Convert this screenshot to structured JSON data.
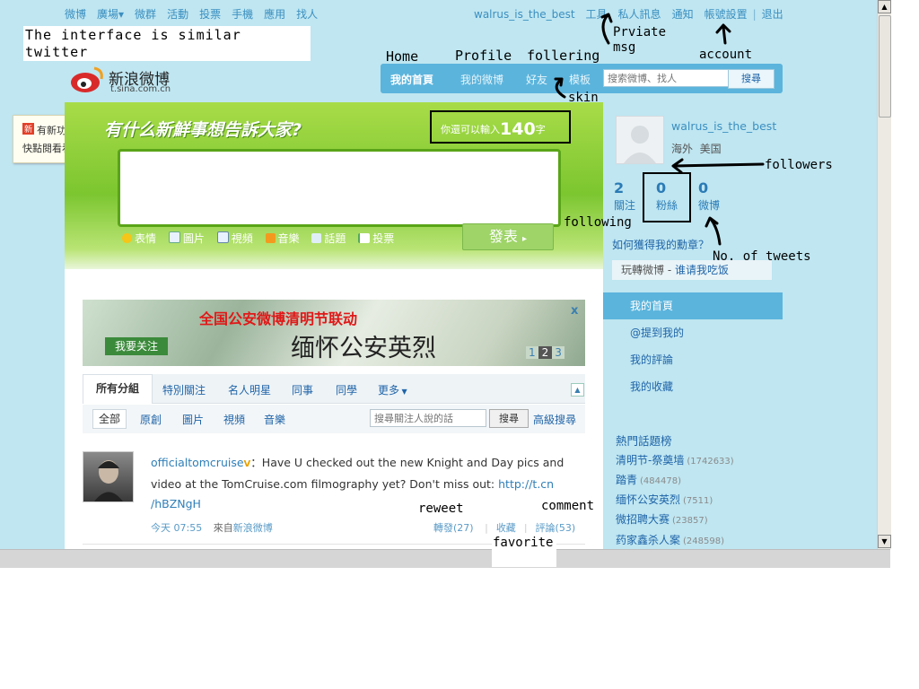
{
  "topnav": {
    "left_links": [
      "微博",
      "廣場▾",
      "微群",
      "活動",
      "投票",
      "手機",
      "應用",
      "找人"
    ],
    "username": "walrus_is_the_best",
    "tools": "工具",
    "private_msg": "私人訊息",
    "notice": "通知",
    "account_settings": "帳號設置",
    "logout": "退出"
  },
  "logo": {
    "main": "新浪微博",
    "sub": "t.sina.com.cn"
  },
  "mainnav": {
    "home": "我的首頁",
    "profile": "我的微博",
    "friends": "好友",
    "template": "模板",
    "search_placeholder": "搜索微博、找人",
    "search_btn": "搜尋"
  },
  "popup": {
    "badge": "新",
    "line1": "有新功能啦",
    "line2": "快點閱看看！",
    "close": "×"
  },
  "composer": {
    "slogan": "有什么新鮮事想告訴大家?",
    "counter_prefix": "你還可以輸入",
    "counter_number": "140",
    "counter_suffix": "字",
    "tools": [
      "表情",
      "圖片",
      "視頻",
      "音樂",
      "話題",
      "投票"
    ],
    "post_btn": "發表"
  },
  "banner": {
    "title": "全国公安微博清明节联动",
    "main": "缅怀公安英烈",
    "follow": "我要关注",
    "pages": [
      "1",
      "2",
      "3"
    ],
    "close": "x"
  },
  "filters": {
    "group_tabs": [
      "所有分組",
      "特別關注",
      "名人明星",
      "同事",
      "同學",
      "更多"
    ],
    "type_tabs": [
      "全部",
      "原創",
      "圖片",
      "視頻",
      "音樂"
    ],
    "search_placeholder": "搜尋關注人說的話",
    "search_btn": "搜尋",
    "advanced": "高級搜尋"
  },
  "tweet": {
    "author": "officialtomcruise",
    "verified": "V",
    "text": "：Have U checked out the new Knight and Day pics and video at the TomCruise.com filmography yet? Don't miss out: ",
    "link": "http://t.cn/hBZNgH",
    "link_part1": "http://t.cn",
    "link_part2": "/hBZNgH",
    "time": "今天 07:55",
    "from_label": "來自",
    "source": "新浪微博",
    "repost": "轉發(27)",
    "favorite": "收藏",
    "comment": "評論(53)"
  },
  "profile": {
    "username": "walrus_is_the_best",
    "location": "海外  美国",
    "following_count": "2",
    "following_label": "關注",
    "followers_count": "0",
    "followers_label": "粉絲",
    "tweets_count": "0",
    "tweets_label": "微博",
    "medal_link": "如何獲得我的勳章？",
    "promo_prefix": "玩轉微博 - ",
    "promo_link": "谁请我吃饭"
  },
  "sidebar": {
    "items": [
      "我的首頁",
      "@提到我的",
      "我的評論",
      "我的收藏"
    ]
  },
  "hot_topics": {
    "title": "熱門話題榜",
    "items": [
      {
        "name": "清明节-祭奠墙",
        "count": "(1742633)"
      },
      {
        "name": "踏青",
        "count": "(484478)"
      },
      {
        "name": "缅怀公安英烈",
        "count": "(7511)"
      },
      {
        "name": "微招聘大赛",
        "count": "(23857)"
      },
      {
        "name": "药家鑫杀人案",
        "count": "(248598)"
      }
    ]
  },
  "annotations": {
    "similar_twitter": "The interface is similar twitter",
    "home": "Home",
    "profile": "Profile",
    "followering": "follering",
    "skin": "skin",
    "private_msg_line1": "Prviate",
    "private_msg_line2": "msg",
    "account": "account",
    "followers": "followers",
    "following": "following",
    "no_of_tweets": "No. of tweets",
    "reweet": "reweet",
    "comment": "comment",
    "favorite": "favorite"
  },
  "colors": {
    "sky": "#bfe6f1",
    "green": "#7cc630",
    "link": "#1f64a8",
    "nav_blue": "#5bb4dc"
  }
}
